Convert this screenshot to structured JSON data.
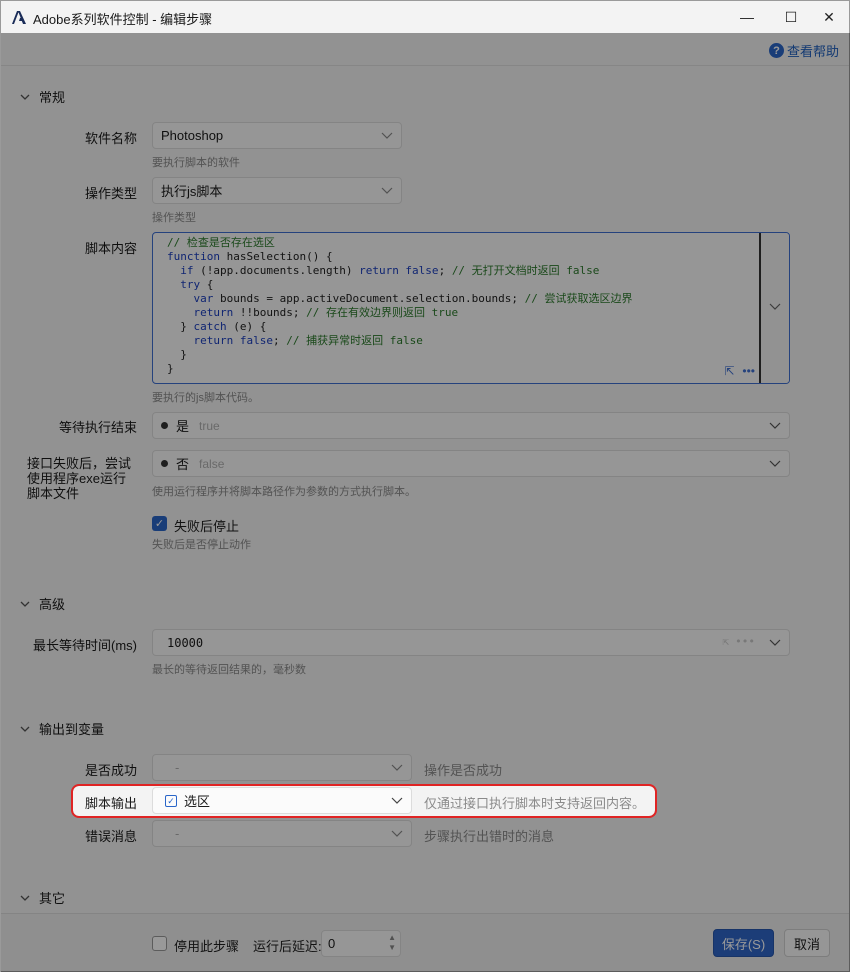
{
  "window": {
    "title": "Adobe系列软件控制 - 编辑步骤",
    "minimize_glyph": "—",
    "maximize_glyph": "☐",
    "close_glyph": "✕"
  },
  "help": {
    "icon": "?",
    "label": "查看帮助"
  },
  "sections": {
    "general": "常规",
    "advanced": "高级",
    "output": "输出到变量",
    "other": "其它"
  },
  "general": {
    "software_label": "软件名称",
    "software_value": "Photoshop",
    "software_hint": "要执行脚本的软件",
    "op_type_label": "操作类型",
    "op_type_value": "执行js脚本",
    "op_type_hint": "操作类型",
    "script_label": "脚本内容",
    "script_hint": "要执行的js脚本代码。",
    "code_lines": [
      "// 检查是否存在选区",
      "function hasSelection() {",
      "  if (!app.documents.length) return false; // 无打开文档时返回 false",
      "  try {",
      "    var bounds = app.activeDocument.selection.bounds; // 尝试获取选区边界",
      "    return !!bounds; // 存在有效边界则返回 true",
      "  } catch (e) {",
      "    return false; // 捕获异常时返回 false",
      "  }",
      "}"
    ],
    "code_tools_more": "•••",
    "code_tools_expand": "⇱",
    "wait_label": "等待执行结束",
    "wait_value": "是",
    "wait_sub": "true",
    "fallback_label": "接口失败后，尝试使用程序exe运行脚本文件",
    "fallback_value": "否",
    "fallback_sub": "false",
    "fallback_hint": "使用运行程序并将脚本路径作为参数的方式执行脚本。",
    "stop_on_fail_label": "失败后停止",
    "stop_on_fail_hint": "失败后是否停止动作"
  },
  "advanced": {
    "timeout_label": "最长等待时间(ms)",
    "timeout_value": "10000",
    "timeout_hint": "最长的等待返回结果的，毫秒数"
  },
  "output": {
    "success_label": "是否成功",
    "success_value": "-",
    "success_hint": "操作是否成功",
    "script_output_label": "脚本输出",
    "script_output_value": "选区",
    "script_output_hint": "仅通过接口执行脚本时支持返回内容。",
    "error_label": "错误消息",
    "error_value": "-",
    "error_hint": "步骤执行出错时的消息"
  },
  "footer": {
    "disable_step_label": "停用此步骤",
    "delay_label": "运行后延迟:",
    "delay_value": "0",
    "save_label": "保存(S)",
    "cancel_label": "取消"
  },
  "colors": {
    "accent": "#2f66c8",
    "highlight": "#e02424",
    "keyword": "#1c3fbf",
    "comment": "#2c7a2c"
  }
}
